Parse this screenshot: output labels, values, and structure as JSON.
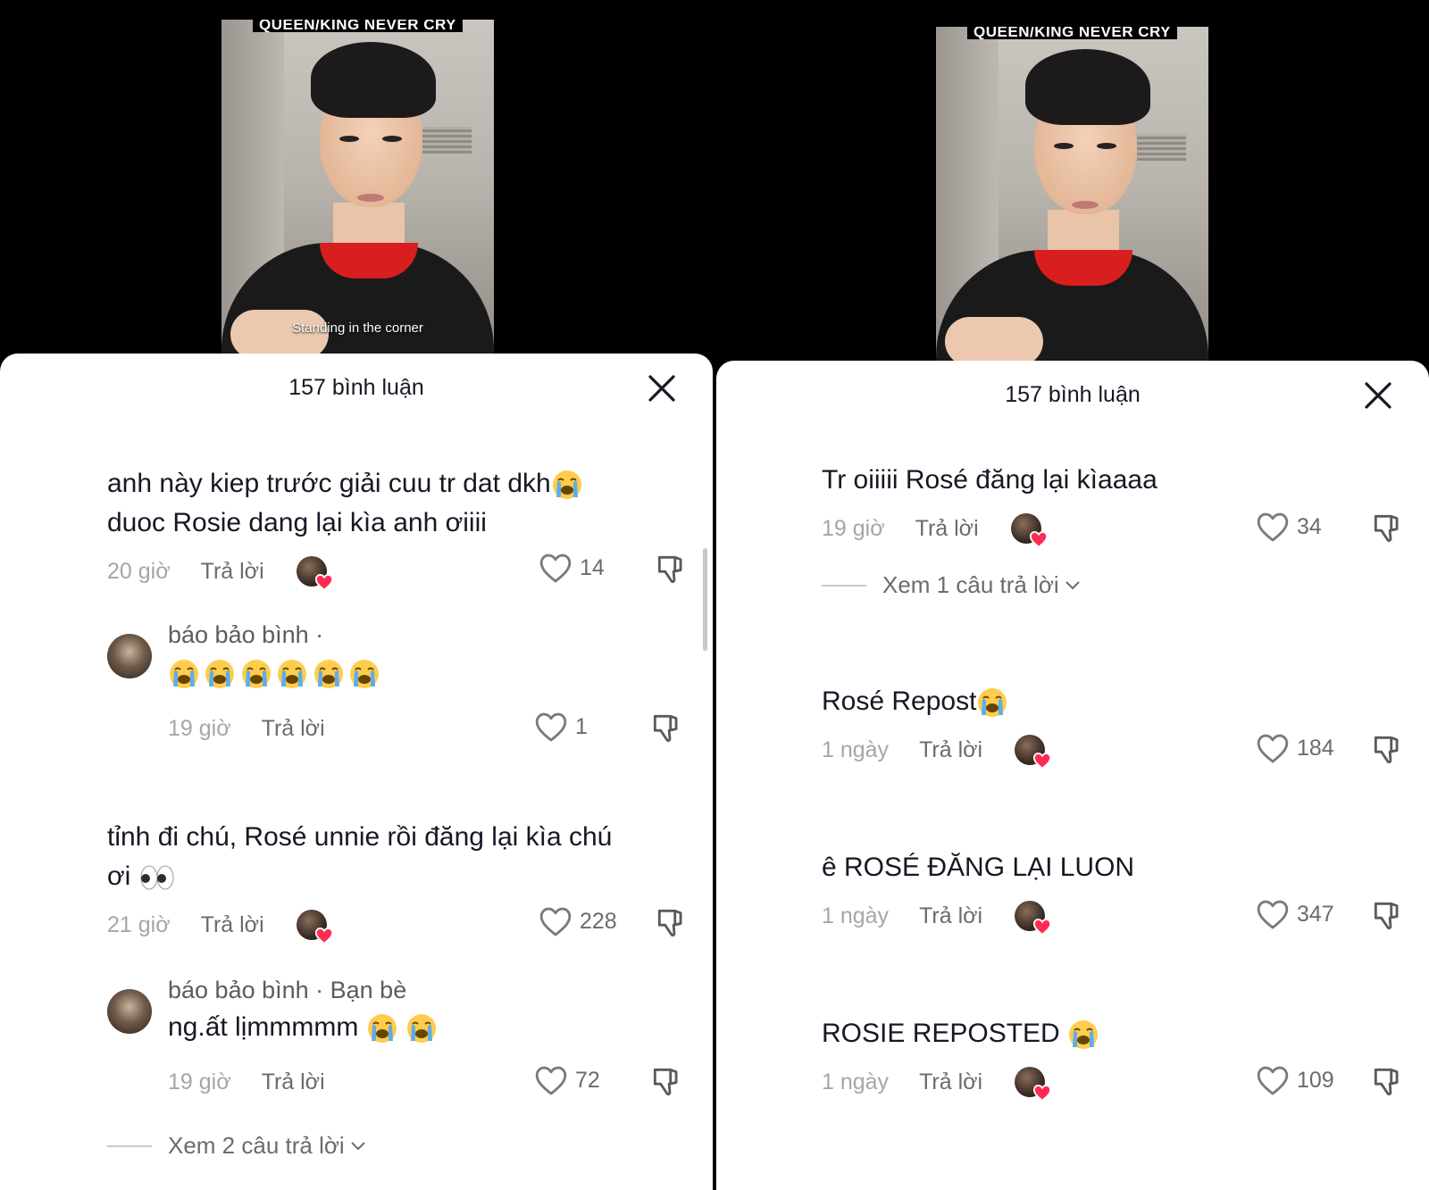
{
  "left": {
    "video": {
      "title": "QUEEN/KING NEVER CRY",
      "caption": "Standing in the corner"
    },
    "header": {
      "title": "157 bình luận"
    },
    "comments": [
      {
        "text_line1": "anh này kiep trước giải cuu tr dat dkh",
        "text_line2": "duoc Rosie dang lại kìa anh ơiiii",
        "time": "20 giờ",
        "reply": "Trả lời",
        "likes": "14"
      },
      {
        "author": "báo bảo bình ·",
        "time": "19 giờ",
        "reply": "Trả lời",
        "likes": "1"
      },
      {
        "text_line1": "tỉnh đi chú, Rosé unnie rồi đăng lại kìa chú",
        "text_line2": "ơi",
        "time": "21 giờ",
        "reply": "Trả lời",
        "likes": "228"
      },
      {
        "author": "báo bảo bình · Bạn bè",
        "text": "ng.ất lịmmmmm",
        "time": "19 giờ",
        "reply": "Trả lời",
        "likes": "72"
      }
    ],
    "view_replies": "Xem 2 câu trả lời"
  },
  "right": {
    "video": {
      "title": "QUEEN/KING NEVER CRY"
    },
    "header": {
      "title": "157 bình luận"
    },
    "comments": [
      {
        "text": "Tr oiiiii Rosé đăng lại kìaaaa",
        "time": "19 giờ",
        "reply": "Trả lời",
        "likes": "34"
      },
      {
        "text": "Rosé Repost",
        "time": "1 ngày",
        "reply": "Trả lời",
        "likes": "184"
      },
      {
        "text": "ê ROSÉ ĐĂNG LẠI LUON",
        "time": "1 ngày",
        "reply": "Trả lời",
        "likes": "347"
      },
      {
        "text": "ROSIE REPOSTED",
        "time": "1 ngày",
        "reply": "Trả lời",
        "likes": "109"
      }
    ],
    "view_replies": "Xem 1 câu trả lời"
  },
  "icons": {
    "close": "close-icon",
    "like": "heart-outline-icon",
    "dislike": "thumbs-down-icon",
    "creator_liked": "creator-heart-badge-icon",
    "expand": "chevron-down-icon",
    "emoji_cry": "loudly-crying-face-emoji",
    "emoji_eyes": "eyes-emoji"
  },
  "colors": {
    "sheet_bg": "#ffffff",
    "text": "#161823",
    "muted": "#a6a6a6",
    "heart_badge": "#fe2c55"
  }
}
